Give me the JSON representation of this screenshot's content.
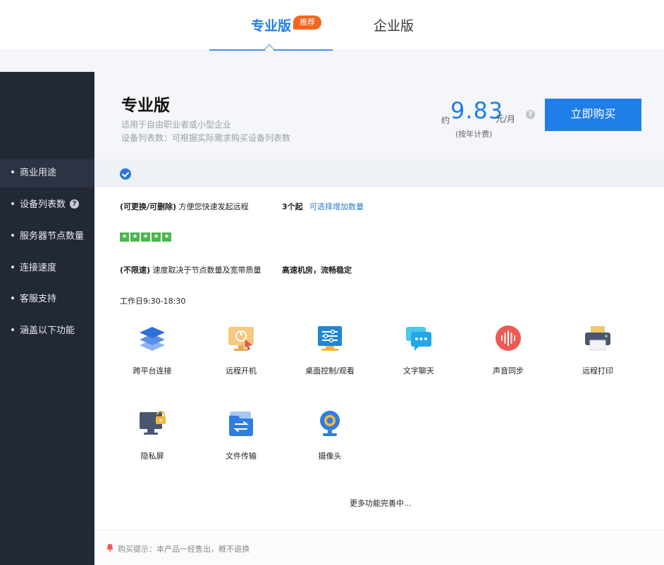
{
  "tabs": {
    "pro": "专业版",
    "badge": "推荐",
    "enterprise": "企业版"
  },
  "sidebar": {
    "items": [
      {
        "label": "商业用途"
      },
      {
        "label": "设备列表数"
      },
      {
        "label": "服务器节点数量"
      },
      {
        "label": "连接速度"
      },
      {
        "label": "客服支持"
      },
      {
        "label": "涵盖以下功能"
      }
    ],
    "help_glyph": "?"
  },
  "header": {
    "title": "专业版",
    "subtitle1": "适用于自由职业者或小型企业",
    "subtitle2": "设备列表数：可根据实际需求购买设备列表数",
    "price_prefix": "约",
    "price": "9.83",
    "price_unit": "元/月",
    "price_note": "(按年计费)",
    "help_glyph": "?",
    "buy_label": "立即购买"
  },
  "rows": {
    "device_desc_bold": "(可更换/可删除)",
    "device_desc": "方便您快速发起远程",
    "device_count": "3个起",
    "device_link": "可选择增加数量",
    "speed_bold": "(不限速)",
    "speed_desc": "速度取决于节点数量及宽带质量",
    "speed_value": "高速机房，流畅稳定",
    "support": "工作日9:30-18:30"
  },
  "server_rating": 5,
  "features": [
    {
      "label": "跨平台连接",
      "icon": "layers-icon"
    },
    {
      "label": "远程开机",
      "icon": "power-monitor-icon"
    },
    {
      "label": "桌面控制/观看",
      "icon": "desktop-control-icon"
    },
    {
      "label": "文字聊天",
      "icon": "chat-icon"
    },
    {
      "label": "声音同步",
      "icon": "audio-wave-icon"
    },
    {
      "label": "远程打印",
      "icon": "printer-icon"
    },
    {
      "label": "隐私屏",
      "icon": "privacy-screen-icon"
    },
    {
      "label": "文件传输",
      "icon": "file-transfer-icon"
    },
    {
      "label": "摄像头",
      "icon": "camera-icon"
    }
  ],
  "more_label": "更多功能完善中...",
  "footer": {
    "text": "购买提示：本产品一经售出，概不退换"
  },
  "colors": {
    "accent": "#1f7ee8",
    "badge": "#f5651f",
    "sidebar": "#232836",
    "stars": "#49b74e"
  }
}
